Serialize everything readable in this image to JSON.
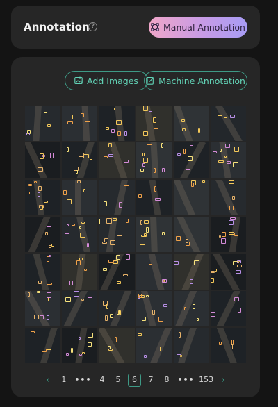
{
  "header": {
    "title": "Annotation",
    "help_icon": "question-circle-icon",
    "manual_button": {
      "label": "Manual Annotation",
      "icon": "bounding-box-icon"
    }
  },
  "toolbar": {
    "add_images": {
      "label": "Add Images",
      "icon": "image-plus-icon"
    },
    "machine_annotation": {
      "label": "Machine Annotation",
      "icon": "edit-square-icon"
    }
  },
  "gallery": {
    "rows": 7,
    "columns": 6,
    "thumbnail_count": 42
  },
  "pagination": {
    "prev_icon": "chevron-left-icon",
    "next_icon": "chevron-right-icon",
    "items": [
      {
        "label": "1",
        "type": "page"
      },
      {
        "label": "•••",
        "type": "ellipsis"
      },
      {
        "label": "4",
        "type": "page"
      },
      {
        "label": "5",
        "type": "page"
      },
      {
        "label": "6",
        "type": "current"
      },
      {
        "label": "7",
        "type": "page"
      },
      {
        "label": "8",
        "type": "page"
      },
      {
        "label": "•••",
        "type": "ellipsis"
      },
      {
        "label": "153",
        "type": "page"
      }
    ],
    "current_page": "6"
  },
  "colors": {
    "background": "#141414",
    "card": "#262626",
    "accent_teal": "#62d3b6",
    "gradient_start": "#f0a6c8",
    "gradient_end": "#a79cf5"
  }
}
